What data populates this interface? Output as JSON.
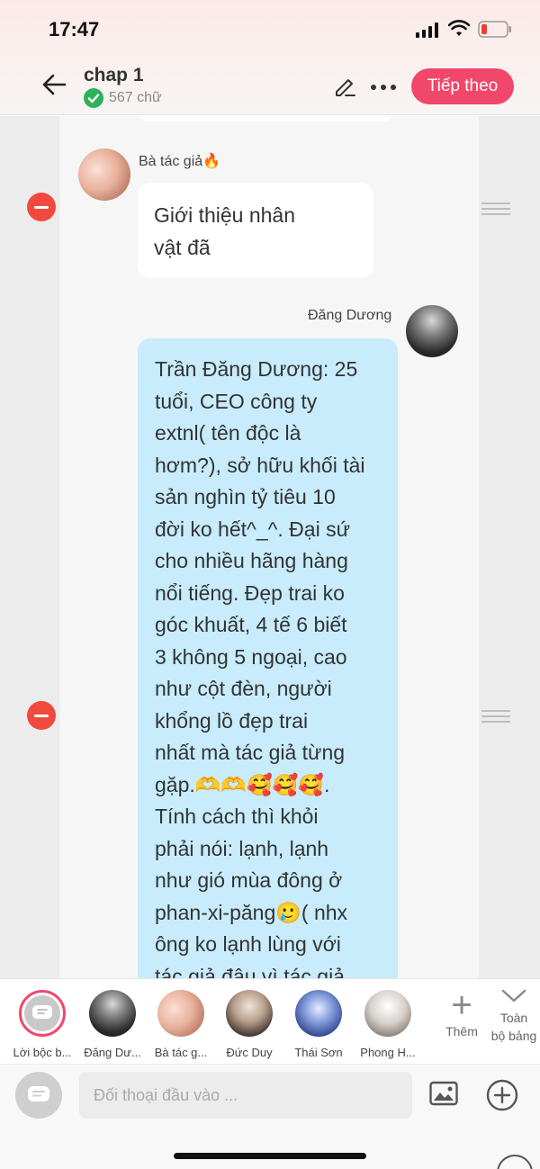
{
  "status_bar": {
    "time": "17:47"
  },
  "header": {
    "back_icon": "arrow-left-icon",
    "title": "chap 1",
    "word_count": "567 chữ",
    "next_label": "Tiếp theo",
    "accent": "#f0476b"
  },
  "messages": [
    {
      "speaker": "Bà tác giả🔥",
      "text": "Giới thiệu nhân\nvật đã",
      "side": "left",
      "bubble_color": "#ffffff"
    },
    {
      "speaker": "Đăng Dương",
      "text": "Trần Đăng Dương: 25\ntuổi, CEO công ty\nextnl( tên độc là\nhơm?), sở hữu khối tài\nsản nghìn tỷ tiêu 10\nđời ko hết^_^. Đại sứ\ncho nhiều hãng hàng\nnổi tiếng. Đẹp trai ko\ngóc khuất, 4 tế 6 biết\n3 không 5 ngoại, cao\nnhư cột đèn, người\nkhổng lồ đẹp trai\nnhất mà tác giả từng\ngặp.🫶🫶🥰🥰🥰.\nTính cách thì khỏi\nphải nói: lạnh, lạnh\nnhư gió mùa đông ở\nphan-xi-păng🥲( nhx\nông ko lạnh lùng với\ntác giả đâu vì tác giả",
      "side": "right",
      "bubble_color": "#c8ecfb"
    }
  ],
  "characters": [
    {
      "name": "Lời bộc b...",
      "avatar": "narrator-icon"
    },
    {
      "name": "Đăng Dư..."
    },
    {
      "name": "Bà tác g..."
    },
    {
      "name": "Đức Duy"
    },
    {
      "name": "Thái Sơn"
    },
    {
      "name": "Phong H..."
    }
  ],
  "strip_actions": {
    "add_label": "Thêm",
    "all_label": "Toàn\nbộ bảng"
  },
  "input": {
    "placeholder": "Đối thoại đầu vào ..."
  }
}
